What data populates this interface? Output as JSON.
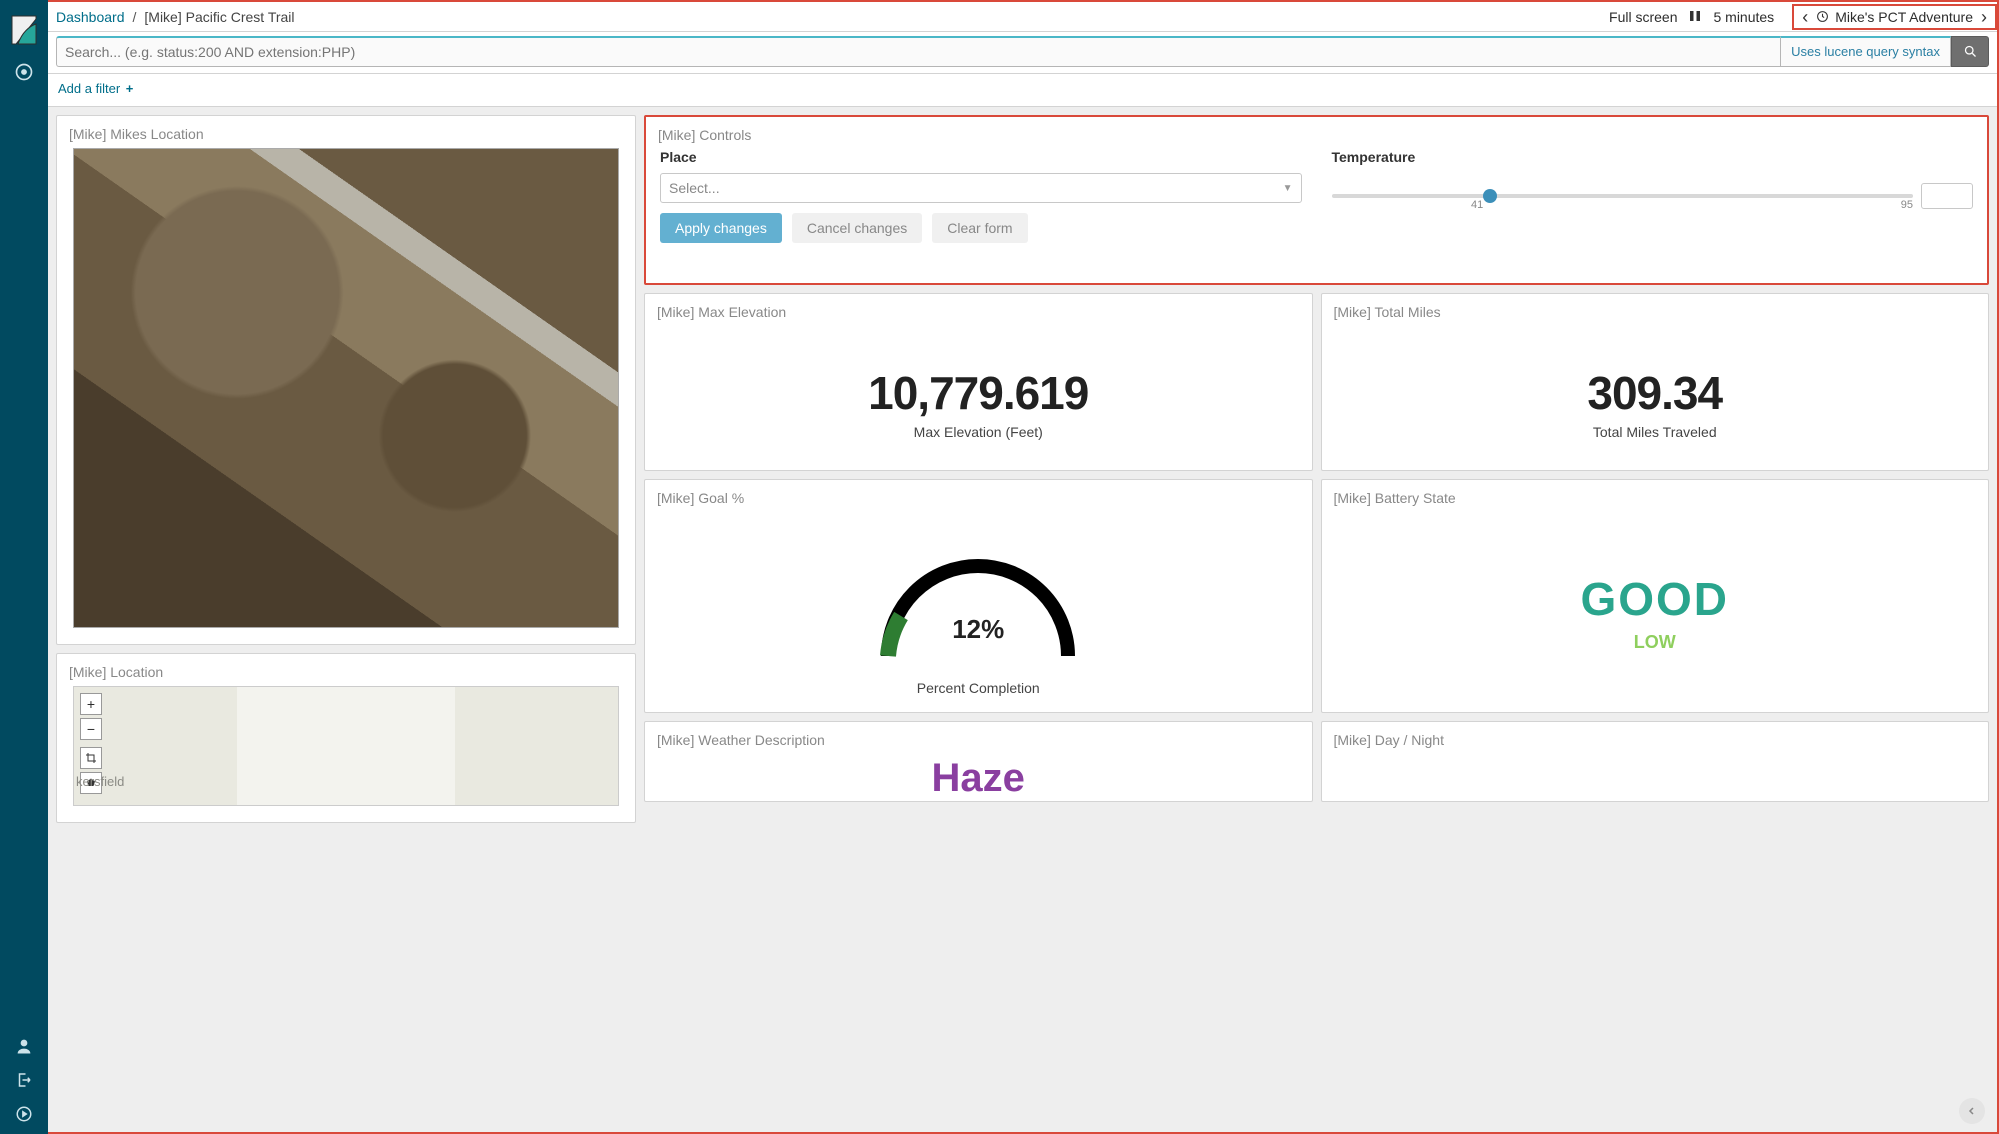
{
  "nav": {
    "logo_name": "kibana-logo",
    "top_icon": "timelion-icon",
    "bottom_icons": [
      "user-icon",
      "logout-icon",
      "play-icon"
    ]
  },
  "breadcrumb": {
    "root": "Dashboard",
    "separator": "/",
    "current": "[Mike] Pacific Crest Trail"
  },
  "topbar": {
    "fullscreen": "Full screen",
    "interval": "5 minutes",
    "time_label": "Mike's PCT Adventure"
  },
  "search": {
    "placeholder": "Search... (e.g. status:200 AND extension:PHP)",
    "syntax_hint": "Uses lucene query syntax"
  },
  "filters": {
    "add_label": "Add a filter"
  },
  "panels": {
    "location_sat": {
      "title": "[Mike] Mikes Location"
    },
    "location_map": {
      "title": "[Mike] Location",
      "place_label": "kersfield"
    },
    "controls": {
      "title": "[Mike] Controls",
      "place_label": "Place",
      "place_placeholder": "Select...",
      "temp_label": "Temperature",
      "temp_min": "41",
      "temp_max": "95",
      "apply": "Apply changes",
      "cancel": "Cancel changes",
      "clear": "Clear form"
    },
    "max_elev": {
      "title": "[Mike] Max Elevation",
      "value": "10,779.619",
      "sub": "Max Elevation (Feet)"
    },
    "total_miles": {
      "title": "[Mike] Total Miles",
      "value": "309.34",
      "sub": "Total Miles Traveled"
    },
    "goal": {
      "title": "[Mike] Goal %",
      "value": "12%",
      "sub": "Percent Completion",
      "percent": 12
    },
    "battery": {
      "title": "[Mike] Battery State",
      "state": "GOOD",
      "sub": "LOW"
    },
    "weather": {
      "title": "[Mike] Weather Description",
      "value": "Haze"
    },
    "daynight": {
      "title": "[Mike] Day / Night"
    }
  },
  "chart_data": {
    "type": "gauge",
    "title": "Percent Completion",
    "value": 12,
    "min": 0,
    "max": 100,
    "unit": "%",
    "fill_color": "#2e7d32",
    "track_color": "#000000"
  }
}
